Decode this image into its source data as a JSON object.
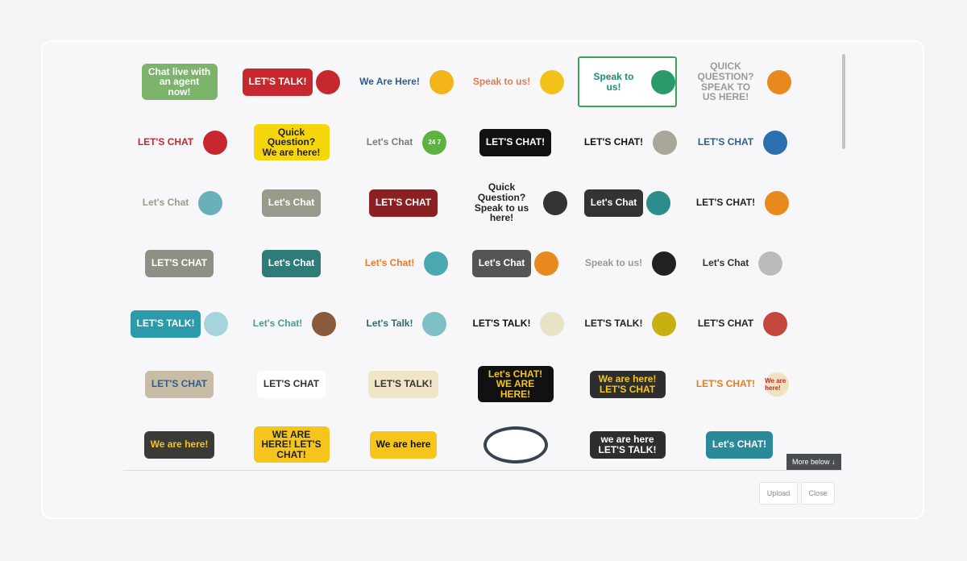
{
  "gallery": {
    "selected_index": 4,
    "items": [
      {
        "text": "Chat live with an agent now!",
        "bg": "#7cb46b",
        "fg": "#ffffff"
      },
      {
        "text": "LET'S TALK!",
        "bg": "#c6282e",
        "fg": "#ffffff",
        "accent": "#c6282e"
      },
      {
        "text": "We Are Here!",
        "bg": "transparent",
        "fg": "#2d5c8a",
        "accent": "#f2b31b"
      },
      {
        "text": "Speak to us!",
        "bg": "transparent",
        "fg": "#e07b4e",
        "accent": "#f2c21b"
      },
      {
        "text": "Speak to us!",
        "bg": "transparent",
        "fg": "#1d8b78",
        "accent": "#2a9a6a"
      },
      {
        "text": "QUICK QUESTION? SPEAK TO US HERE!",
        "bg": "transparent",
        "fg": "#9a9a9a",
        "accent": "#e8891e"
      },
      {
        "text": "LET'S CHAT",
        "bg": "transparent",
        "fg": "#c6282e",
        "accent": "#c6282e"
      },
      {
        "text": "Quick Question? We are here!",
        "bg": "#f5d50b",
        "fg": "#222222"
      },
      {
        "text": "Let's Chat",
        "bg": "transparent",
        "fg": "#7a7a7a",
        "accent": "#5db33f",
        "accent_text": "24 7"
      },
      {
        "text": "LET'S CHAT!",
        "bg": "#111111",
        "fg": "#ffffff"
      },
      {
        "text": "LET'S CHAT!",
        "bg": "transparent",
        "fg": "#111111",
        "accent": "#a9a79a"
      },
      {
        "text": "LET'S CHAT",
        "bg": "transparent",
        "fg": "#2c5f8a",
        "accent": "#2c6fb0"
      },
      {
        "text": "Let's Chat",
        "bg": "transparent",
        "fg": "#9a9a8c",
        "accent": "#6ab0b8"
      },
      {
        "text": "Let's Chat",
        "bg": "#9a9a8c",
        "fg": "#ffffff"
      },
      {
        "text": "LET'S CHAT",
        "bg": "#8c1f1f",
        "fg": "#ffffff"
      },
      {
        "text": "Quick Question? Speak to us here!",
        "bg": "transparent",
        "fg": "#222222",
        "accent": "#333333"
      },
      {
        "text": "Let's Chat",
        "bg": "#333333",
        "fg": "#ffffff",
        "accent": "#2d8c8c"
      },
      {
        "text": "LET'S CHAT!",
        "bg": "transparent",
        "fg": "#222222",
        "accent": "#e8891e"
      },
      {
        "text": "LET'S CHAT",
        "bg": "#8f8f85",
        "fg": "#ffffff"
      },
      {
        "text": "Let's Chat",
        "bg": "#2d7c77",
        "fg": "#ffffff"
      },
      {
        "text": "Let's Chat!",
        "bg": "transparent",
        "fg": "#e57d1e",
        "accent": "#4aa9b0"
      },
      {
        "text": "Let's Chat",
        "bg": "#555555",
        "fg": "#ffffff",
        "accent": "#e8891e"
      },
      {
        "text": "Speak to us!",
        "bg": "transparent",
        "fg": "#999999",
        "accent": "#222222"
      },
      {
        "text": "Let's Chat",
        "bg": "transparent",
        "fg": "#333333",
        "accent": "#bbbbbb"
      },
      {
        "text": "LET'S TALK!",
        "bg": "#2b9aaa",
        "fg": "#ffffff",
        "accent": "#a6d4dc"
      },
      {
        "text": "Let's Chat!",
        "bg": "transparent",
        "fg": "#4a9a92",
        "accent": "#8a5a3a"
      },
      {
        "text": "Let's Talk!",
        "bg": "transparent",
        "fg": "#2d6c6c",
        "accent": "#7fc0c8"
      },
      {
        "text": "LET'S TALK!",
        "bg": "transparent",
        "fg": "#111111",
        "accent": "#e8e2c6"
      },
      {
        "text": "LET'S TALK!",
        "bg": "transparent",
        "fg": "#222222",
        "accent": "#c8b012"
      },
      {
        "text": "LET'S CHAT",
        "bg": "transparent",
        "fg": "#222222",
        "accent": "#c4463c"
      },
      {
        "text": "LET'S CHAT",
        "bg": "#c8bca6",
        "fg": "#2c5f8a"
      },
      {
        "text": "LET'S CHAT",
        "bg": "#ffffff",
        "fg": "#333333"
      },
      {
        "text": "LET'S TALK!",
        "bg": "#efe6c8",
        "fg": "#333333"
      },
      {
        "text": "Let's CHAT! WE ARE HERE!",
        "bg": "#111111",
        "fg": "#f5c51b"
      },
      {
        "text": "We are here! LET'S CHAT",
        "bg": "#2e2e2e",
        "fg": "#f5c51b"
      },
      {
        "text": "LET'S CHAT!",
        "bg": "transparent",
        "fg": "#e57d1e",
        "accent": "#efe2c0",
        "accent_text": "We are here!"
      },
      {
        "text": "We are here!",
        "bg": "#3a3a36",
        "fg": "#f5c51b"
      },
      {
        "text": "WE ARE HERE! LET'S CHAT!",
        "bg": "#f5c51b",
        "fg": "#222222"
      },
      {
        "text": "We are here",
        "bg": "#f5c51b",
        "fg": "#111111"
      },
      {
        "text": "",
        "bg": "#ffffff",
        "fg": "#333333",
        "border": "#3a4150"
      },
      {
        "text": "we are here LET'S TALK!",
        "bg": "#2e2e2e",
        "fg": "#ffffff"
      },
      {
        "text": "Let's CHAT!",
        "bg": "#2b8a9a",
        "fg": "#ffffff"
      }
    ]
  },
  "more_below_label": "More below ↓",
  "buttons": {
    "upload": "Upload",
    "close": "Close"
  }
}
